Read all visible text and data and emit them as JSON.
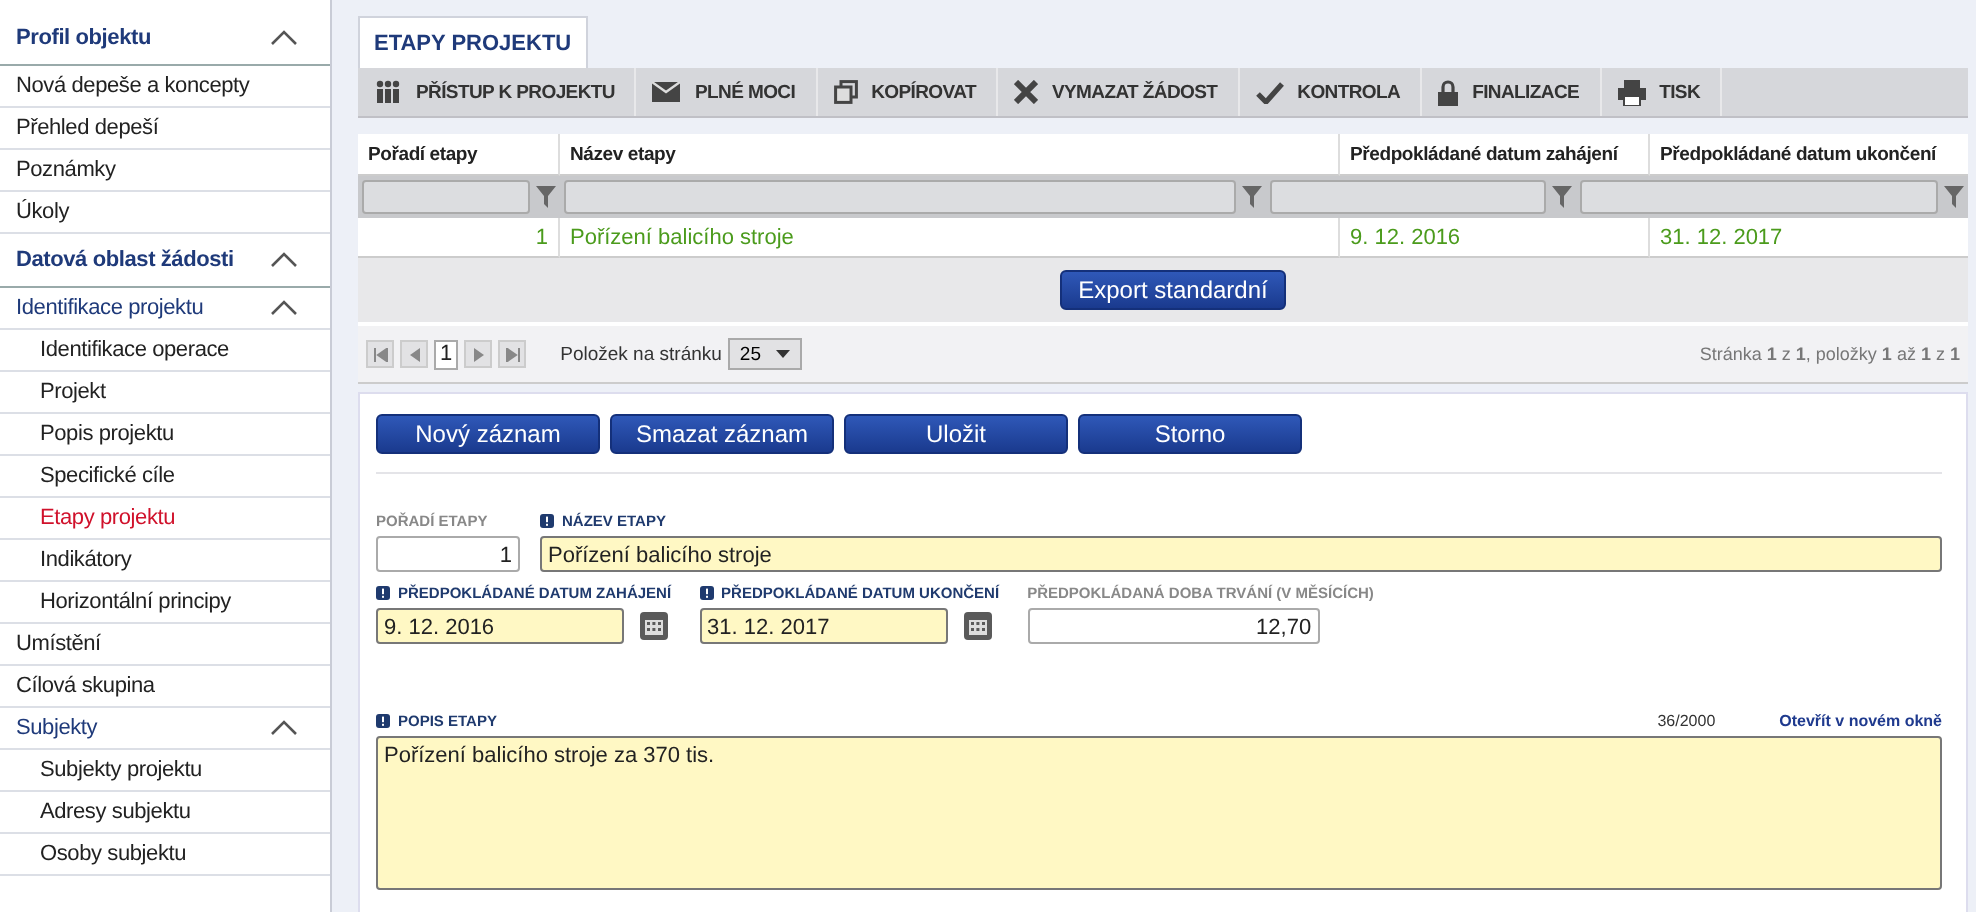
{
  "sidebar": {
    "sections": [
      {
        "label": "Profil objektu",
        "expanded": true,
        "items": [
          {
            "label": "Nová depeše a koncepty",
            "selected": false
          },
          {
            "label": "Přehled depeší",
            "selected": false
          },
          {
            "label": "Poznámky",
            "selected": false
          },
          {
            "label": "Úkoly",
            "selected": false
          }
        ]
      },
      {
        "label": "Datová oblast žádosti",
        "expanded": true,
        "items": [
          {
            "label": "Identifikace projektu",
            "selected": false,
            "expanded": true,
            "children": [
              {
                "label": "Identifikace operace",
                "selected": false
              },
              {
                "label": "Projekt",
                "selected": false
              },
              {
                "label": "Popis projektu",
                "selected": false
              },
              {
                "label": "Specifické cíle",
                "selected": false
              },
              {
                "label": "Etapy projektu",
                "selected": true
              },
              {
                "label": "Indikátory",
                "selected": false
              },
              {
                "label": "Horizontální principy",
                "selected": false
              }
            ]
          },
          {
            "label": "Umístění",
            "selected": false
          },
          {
            "label": "Cílová skupina",
            "selected": false
          },
          {
            "label": "Subjekty",
            "selected": false,
            "expanded": true,
            "children": [
              {
                "label": "Subjekty projektu",
                "selected": false
              },
              {
                "label": "Adresy subjektu",
                "selected": false
              },
              {
                "label": "Osoby subjektu",
                "selected": false
              }
            ]
          }
        ]
      }
    ]
  },
  "tab": {
    "label": "ETAPY PROJEKTU",
    "selected": true
  },
  "toolbar": [
    {
      "kind": "access",
      "label": "PŘÍSTUP K PROJEKTU"
    },
    {
      "kind": "mandates",
      "label": "PLNÉ MOCI"
    },
    {
      "kind": "copy",
      "label": "KOPÍROVAT"
    },
    {
      "kind": "delete",
      "label": "VYMAZAT ŽÁDOST"
    },
    {
      "kind": "verify",
      "label": "KONTROLA"
    },
    {
      "kind": "finalize",
      "label": "FINALIZACE"
    },
    {
      "kind": "print",
      "label": "TISK"
    }
  ],
  "table": {
    "columns": [
      "Pořadí etapy",
      "Název etapy",
      "Předpokládané datum zahájení",
      "Předpokládané datum ukončení"
    ],
    "rows": [
      {
        "cells": [
          "1",
          "Pořízení balicího stroje",
          "9. 12. 2016",
          "31. 12. 2017"
        ]
      }
    ]
  },
  "export_button": "Export standardní",
  "pager": {
    "page": "1",
    "per_page_label": "Položek na stránku",
    "per_page": "25",
    "summary": "Stránka **1** z **1**, položky **1** až **1** z **1**"
  },
  "form": {
    "buttons": [
      "Nový záznam",
      "Smazat záznam",
      "Uložit",
      "Storno"
    ],
    "rows": [
      [
        {
          "kind": "number",
          "label": "POŘADÍ ETAPY",
          "required": false,
          "value": "1"
        },
        {
          "kind": "text",
          "label": "NÁZEV ETAPY",
          "required": true,
          "value": "Pořízení balicího stroje"
        }
      ],
      [
        {
          "kind": "date",
          "label": "PŘEDPOKLÁDANÉ DATUM ZAHÁJENÍ",
          "required": true,
          "value": "9. 12. 2016"
        },
        {
          "kind": "date",
          "label": "PŘEDPOKLÁDANÉ DATUM UKONČENÍ",
          "required": true,
          "value": "31. 12. 2017"
        },
        {
          "kind": "number",
          "label": "PŘEDPOKLÁDANÁ DOBA TRVÁNÍ (V MĚSÍCÍCH)",
          "required": false,
          "value": "12,70"
        }
      ],
      [
        {
          "kind": "textarea",
          "label": "POPIS ETAPY",
          "required": true,
          "value": "Pořízení balicího stroje za 370 tis.",
          "counter": "36/2000",
          "link": "Otevřít v novém okně"
        }
      ]
    ]
  }
}
